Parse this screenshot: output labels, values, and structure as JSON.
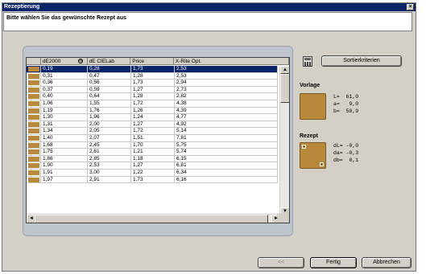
{
  "window": {
    "title": "Rezeptierung",
    "close_glyph": "×"
  },
  "instruction": "Bitte wählen Sie das gewünschte Rezept aus",
  "table": {
    "columns": [
      "",
      "dE2000",
      "dE CIELab",
      "Price",
      "X-Rite Opt."
    ],
    "sort_icon": "⊖",
    "swatch_color": "#b8893a",
    "rows": [
      [
        "0,19",
        "0,28",
        "1,73",
        "2,53"
      ],
      [
        "0,31",
        "0,47",
        "1,28",
        "2,53"
      ],
      [
        "0,36",
        "0,56",
        "1,73",
        "2,94"
      ],
      [
        "0,37",
        "0,59",
        "1,27",
        "2,73"
      ],
      [
        "0,40",
        "0,64",
        "1,28",
        "2,82"
      ],
      [
        "1,06",
        "1,55",
        "1,72",
        "4,38"
      ],
      [
        "1,19",
        "1,76",
        "1,26",
        "4,39"
      ],
      [
        "1,30",
        "1,96",
        "1,24",
        "4,77"
      ],
      [
        "1,31",
        "2,00",
        "1,27",
        "4,92"
      ],
      [
        "1,34",
        "2,05",
        "1,72",
        "5,14"
      ],
      [
        "1,40",
        "2,07",
        "1,51",
        "7,81"
      ],
      [
        "1,68",
        "2,45",
        "1,70",
        "5,75"
      ],
      [
        "1,75",
        "2,61",
        "1,21",
        "5,74"
      ],
      [
        "1,86",
        "2,85",
        "1,18",
        "6,15"
      ],
      [
        "1,90",
        "2,53",
        "1,27",
        "6,81"
      ],
      [
        "1,91",
        "3,00",
        "1,22",
        "6,34"
      ],
      [
        "1,97",
        "2,91",
        "1,73",
        "6,16"
      ]
    ],
    "selected_row": 0
  },
  "buttons": {
    "sort": "Sortierkriterien",
    "back": "<<",
    "finish": "Fertig",
    "cancel": "Abbrechen"
  },
  "vorlage": {
    "label": "Vorlage",
    "color": "#b8893a",
    "values": [
      "L=  61,0",
      "a=   9,0",
      "b=  50,9"
    ]
  },
  "rezept": {
    "label": "Rezept",
    "color": "#b8893a",
    "values": [
      "dL= -0,0",
      "da= -0,3",
      "db=  0,1"
    ]
  },
  "scroll": {
    "up": "▲",
    "down": "▼",
    "left": "◄",
    "right": "►"
  },
  "icons": {
    "calculator": "calculator-icon"
  }
}
